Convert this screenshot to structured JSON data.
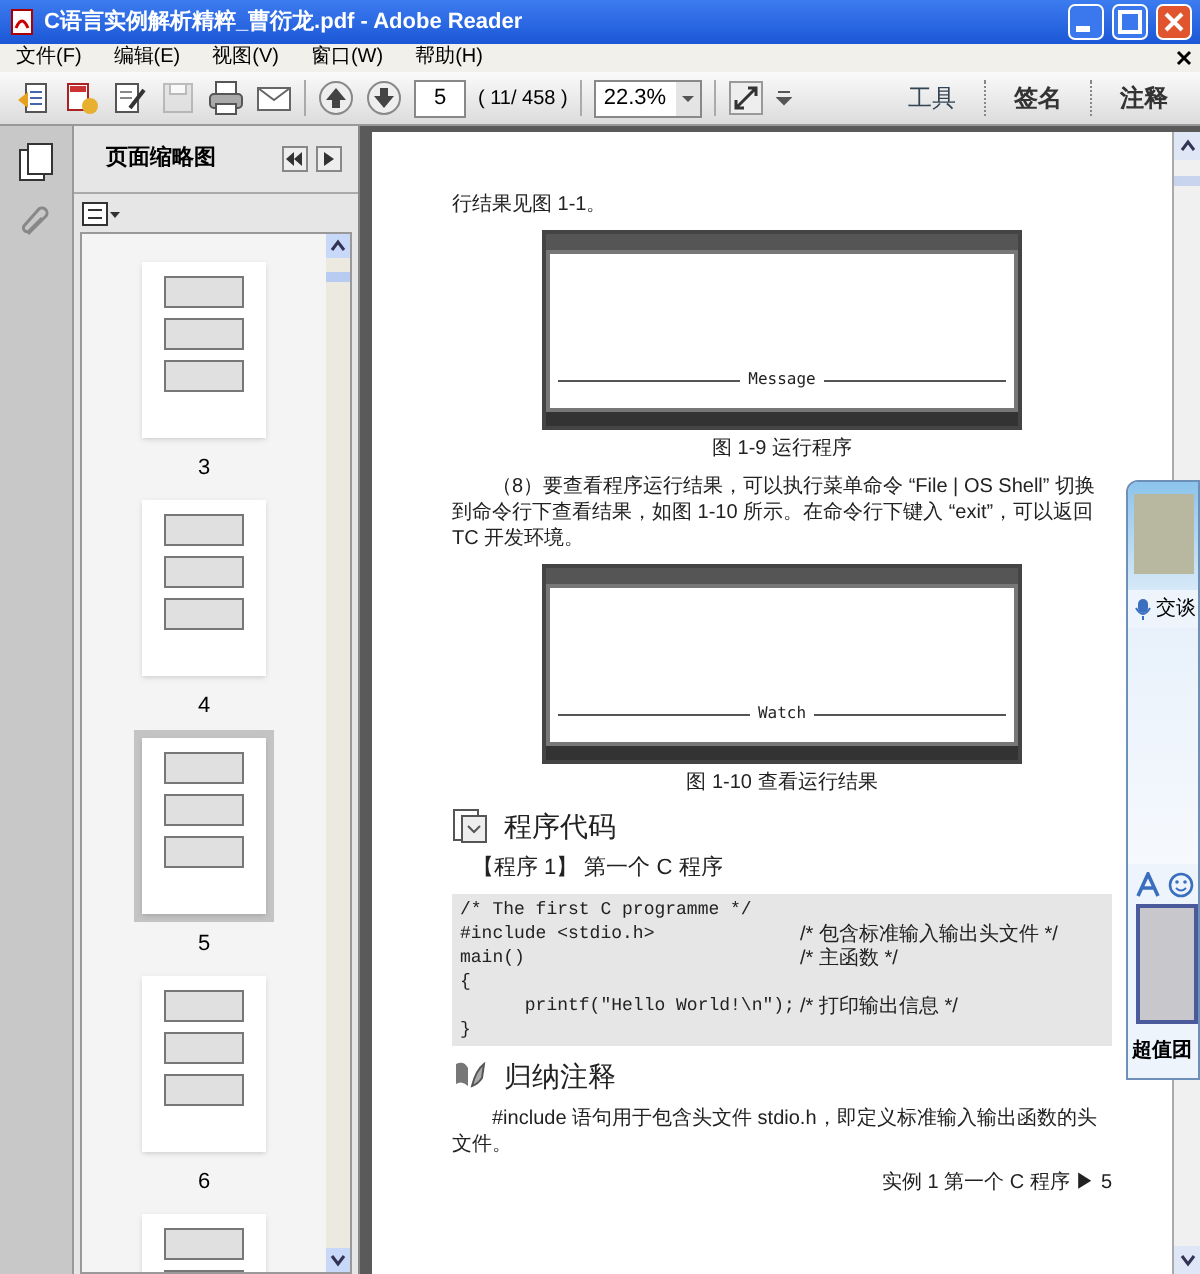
{
  "window": {
    "title": "C语言实例解析精粹_曹衍龙.pdf - Adobe Reader"
  },
  "menu": [
    "文件(F)",
    "编辑(E)",
    "视图(V)",
    "窗口(W)",
    "帮助(H)"
  ],
  "toolbar": {
    "page_number": "5",
    "page_count": "( 11/ 458 )",
    "zoom": "22.3%",
    "panels": [
      "工具",
      "签名",
      "注释"
    ]
  },
  "navigation_panel": {
    "title": "页面缩略图",
    "thumbnails": [
      {
        "label": "3",
        "selected": false
      },
      {
        "label": "4",
        "selected": false
      },
      {
        "label": "5",
        "selected": true
      },
      {
        "label": "6",
        "selected": false
      },
      {
        "selected": false
      }
    ]
  },
  "document": {
    "blocks": [
      {
        "kind": "text",
        "text": "行结果见图 1-1。"
      },
      {
        "kind": "figure",
        "pane_label": "Message",
        "caption": "图 1-9  运行程序"
      },
      {
        "kind": "paragraph",
        "text": "（8）要查看程序运行结果，可以执行菜单命令 “File | OS Shell” 切换到命令行下查看结果，如图 1-10 所示。在命令行下键入 “exit”，可以返回 TC 开发环境。"
      },
      {
        "kind": "figure",
        "pane_label": "Watch",
        "caption": "图 1-10  查看运行结果"
      },
      {
        "kind": "heading",
        "text": "程序代码"
      },
      {
        "kind": "program_title",
        "text": "【程序 1】  第一个 C 程序"
      },
      {
        "kind": "code",
        "lines": [
          {
            "code": "/* The first C programme */"
          },
          {
            "code": "#include <stdio.h>",
            "comment": "/* 包含标准输入输出头文件 */"
          },
          {
            "code": "main()",
            "comment": "/* 主函数 */"
          },
          {
            "code": "{"
          },
          {
            "code": "      printf(\"Hello World!\\n\");",
            "comment": "/* 打印输出信息 */"
          },
          {
            "code": "}"
          }
        ]
      },
      {
        "kind": "heading",
        "text": "归纳注释"
      },
      {
        "kind": "paragraph",
        "text": "#include 语句用于包含头文件 stdio.h，即定义标准输入输出函数的头文件。"
      },
      {
        "kind": "footer",
        "text": "实例 1  第一个 C 程序 ▶ 5"
      }
    ]
  },
  "chat_window": {
    "tab": "交谈",
    "banner": "超值团"
  }
}
